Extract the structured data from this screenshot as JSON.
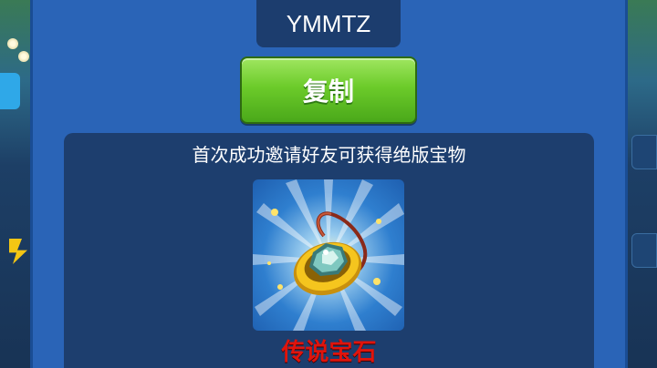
{
  "invite": {
    "code": "YMMTZ",
    "copy_label": "复制"
  },
  "reward": {
    "description": "首次成功邀请好友可获得绝版宝物",
    "item_name": "传说宝石",
    "item_icon": "legendary-gem-amulet",
    "name_color": "#e0140c"
  },
  "colors": {
    "panel": "#2a64b7",
    "button": "#6ccb2a"
  }
}
